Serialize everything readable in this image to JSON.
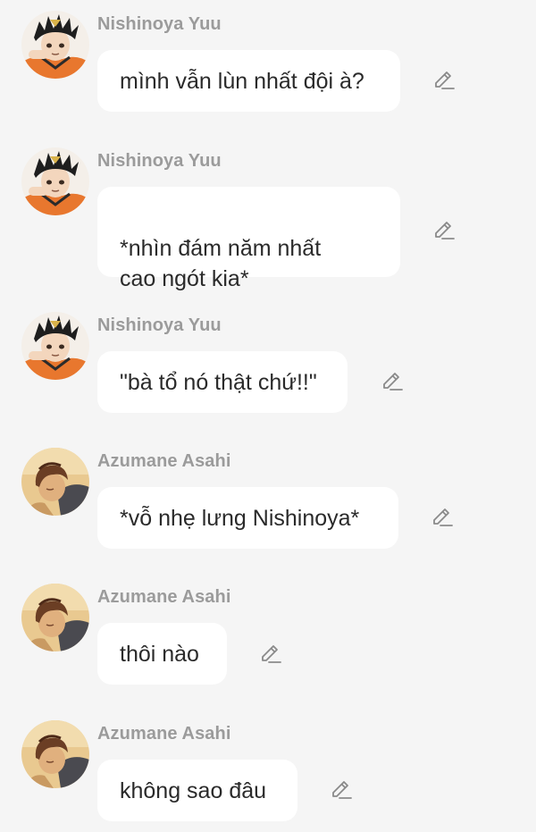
{
  "messages": [
    {
      "sender": "Nishinoya Yuu",
      "text": "mình vẫn lùn nhất đội à?",
      "avatar": "nishinoya-avatar"
    },
    {
      "sender": "Nishinoya Yuu",
      "text": "*nhìn đám năm nhất\ncao ngót kia*",
      "avatar": "nishinoya-avatar"
    },
    {
      "sender": "Nishinoya Yuu",
      "text": "\"bà tổ nó thật chứ!!\"",
      "avatar": "nishinoya-avatar"
    },
    {
      "sender": "Azumane Asahi",
      "text": "*vỗ nhẹ lưng Nishinoya*",
      "avatar": "asahi-avatar"
    },
    {
      "sender": "Azumane Asahi",
      "text": "thôi nào",
      "avatar": "asahi-avatar"
    },
    {
      "sender": "Azumane Asahi",
      "text": "không sao đâu",
      "avatar": "asahi-avatar"
    }
  ],
  "icons": {
    "edit": "pencil-icon"
  },
  "colors": {
    "background": "#f5f5f5",
    "bubble": "#ffffff",
    "sender_name": "#9b9b9b",
    "message_text": "#2a2a2a",
    "icon": "#8a8a8a"
  }
}
